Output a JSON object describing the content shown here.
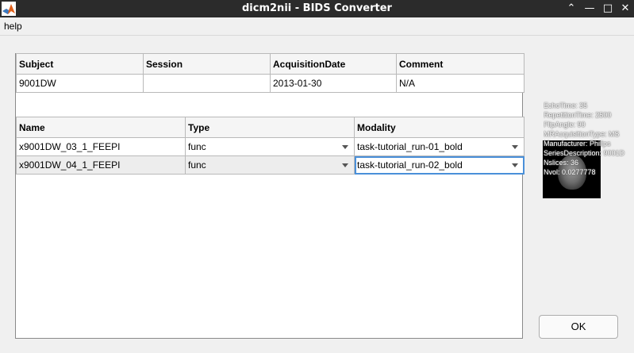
{
  "window": {
    "title": "dicm2nii - BIDS Converter"
  },
  "menu": {
    "items": [
      "help"
    ]
  },
  "subject_table": {
    "headers": [
      "Subject",
      "Session",
      "AcquisitionDate",
      "Comment"
    ],
    "rows": [
      [
        "9001DW",
        "",
        "2013-01-30",
        "N/A"
      ]
    ]
  },
  "series_table": {
    "headers": [
      "Name",
      "Type",
      "Modality"
    ],
    "rows": [
      [
        "x9001DW_03_1_FEEPI",
        "func",
        "task-tutorial_run-01_bold"
      ],
      [
        "x9001DW_04_1_FEEPI",
        "func",
        "task-tutorial_run-02_bold"
      ]
    ]
  },
  "metadata": {
    "lines": [
      "EchoTime:  35",
      "RepetitionTime:  2500",
      "FlipAngle:  90",
      "MRAcquisitionType:  MS",
      "Manufacturer:  Philips",
      "SeriesDescription:  9001D",
      "Nslices:  36",
      "Nvol:  0.0277778"
    ]
  },
  "buttons": {
    "ok": "OK"
  }
}
